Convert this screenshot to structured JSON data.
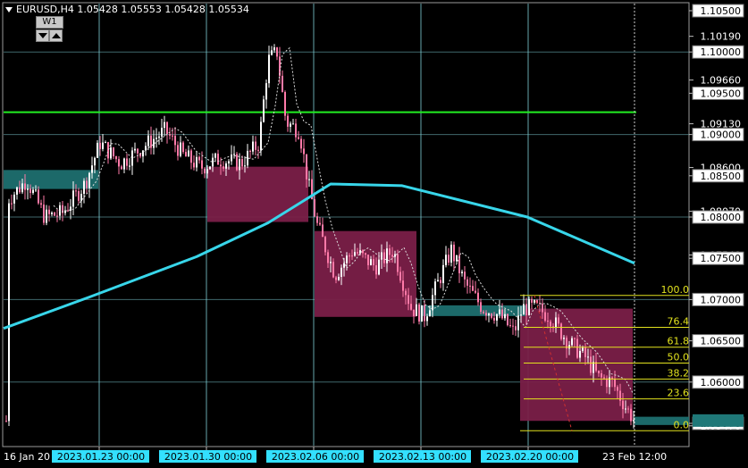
{
  "window": {
    "symbol_line": "EURUSD,H4  1.05428 1.05553 1.05428 1.05534",
    "timeframe_button": "W1"
  },
  "colors": {
    "background": "#000000",
    "grid": "#7fd0d8",
    "bull_candle": "#ffffff",
    "bear_candle": "#ff7aa8",
    "zone": "#7a1f48",
    "demand_zone": "#1d6f6f",
    "moving_average": "#38d6ea",
    "green_level": "#22ee22",
    "fib": "#e2e21e",
    "price_box_bg": "#ffffff",
    "current_price_bg": "#1f7878"
  },
  "price_axis": {
    "labels": [
      "1.10500",
      "1.10190",
      "1.10000",
      "1.09660",
      "1.09500",
      "1.09130",
      "1.09000",
      "1.08600",
      "1.08500",
      "1.08070",
      "1.08000",
      "1.07540",
      "1.07500",
      "1.07000",
      "1.06500",
      "1.06000",
      "1.05500",
      "1.05470"
    ],
    "boxed": [
      "1.10500",
      "1.10000",
      "1.09500",
      "1.09000",
      "1.08500",
      "1.08000",
      "1.07500",
      "1.07000",
      "1.06500",
      "1.06000",
      "1.05500"
    ],
    "current_price": "1.05534"
  },
  "time_axis": {
    "plain_labels": [
      "16 Jan 20",
      "23 Feb 12:00"
    ],
    "highlighted_labels": [
      "2023.01.23 00:00",
      "2023.01.30 00:00",
      "2023.02.06 00:00",
      "2023.02.13 00:00",
      "2023.02.20 00:00"
    ]
  },
  "fibonacci": {
    "levels": [
      "100.0",
      "76.4",
      "61.8",
      "50.0",
      "38.2",
      "23.6",
      "0.0"
    ]
  },
  "chart_data": {
    "type": "candlestick",
    "symbol": "EURUSD",
    "timeframe": "H4",
    "ylim": [
      1.0536,
      1.1057
    ],
    "green_horizontal_level": 1.0927,
    "vertical_markers": [
      "2023.01.23 00:00",
      "2023.01.30 00:00",
      "2023.02.06 00:00",
      "2023.02.13 00:00",
      "2023.02.20 00:00"
    ],
    "moving_average_approx": [
      {
        "time": "2023.01.16",
        "value": 1.0665
      },
      {
        "time": "2023.01.23",
        "value": 1.0703
      },
      {
        "time": "2023.01.30",
        "value": 1.0752
      },
      {
        "time": "2023.02.03",
        "value": 1.0793
      },
      {
        "time": "2023.02.06",
        "value": 1.084
      },
      {
        "time": "2023.02.13",
        "value": 1.0838
      },
      {
        "time": "2023.02.20",
        "value": 1.08
      },
      {
        "time": "2023.02.23",
        "value": 1.0744
      }
    ],
    "zones": [
      {
        "kind": "supply",
        "from": 1.0794,
        "to": 1.0861
      },
      {
        "kind": "supply",
        "from": 1.0679,
        "to": 1.0783
      },
      {
        "kind": "supply",
        "from": 1.0553,
        "to": 1.0689
      },
      {
        "kind": "demand",
        "from": 1.0834,
        "to": 1.0857
      },
      {
        "kind": "demand",
        "from": 1.068,
        "to": 1.0693
      },
      {
        "kind": "demand",
        "from": 1.0548,
        "to": 1.0558
      }
    ],
    "fibonacci": {
      "level_100": 1.0705,
      "level_0": 1.0541
    }
  }
}
